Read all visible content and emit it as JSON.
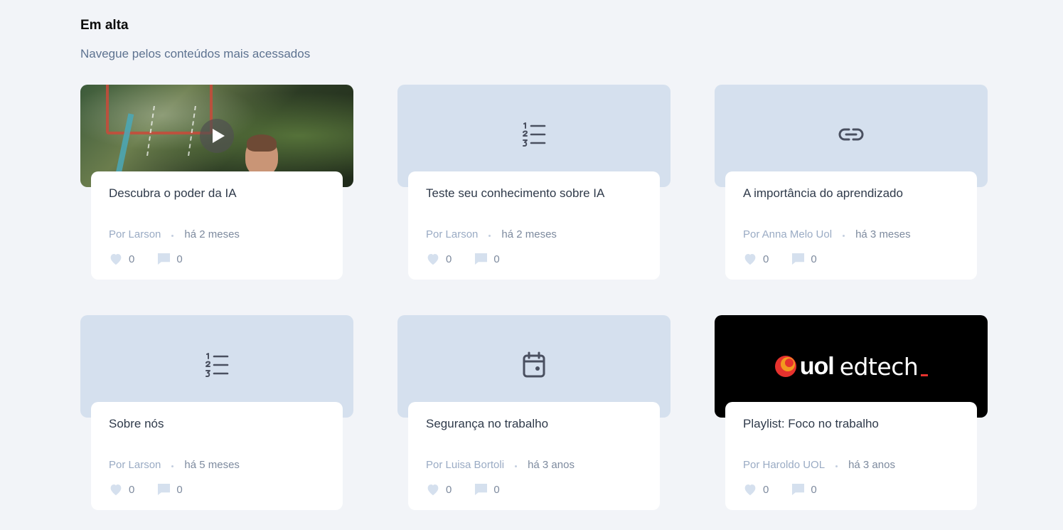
{
  "section": {
    "title": "Em alta",
    "subtitle": "Navegue pelos conteúdos mais acessados"
  },
  "cards": [
    {
      "thumb": "video-thumbnail",
      "icon": "play-icon",
      "title": "Descubra o poder da IA",
      "author": "Por Larson",
      "time": "há 2 meses",
      "likes": "0",
      "comments": "0"
    },
    {
      "thumb": "placeholder",
      "icon": "numbered-list-icon",
      "title": "Teste seu conhecimento sobre IA",
      "author": "Por Larson",
      "time": "há 2 meses",
      "likes": "0",
      "comments": "0"
    },
    {
      "thumb": "placeholder",
      "icon": "link-icon",
      "title": "A importância do aprendizado",
      "author": "Por Anna Melo Uol",
      "time": "há 3 meses",
      "likes": "0",
      "comments": "0"
    },
    {
      "thumb": "placeholder",
      "icon": "numbered-list-icon",
      "title": "Sobre nós",
      "author": "Por Larson",
      "time": "há 5 meses",
      "likes": "0",
      "comments": "0"
    },
    {
      "thumb": "placeholder",
      "icon": "calendar-icon",
      "title": "Segurança no trabalho",
      "author": "Por Luisa Bortoli",
      "time": "há 3 anos",
      "likes": "0",
      "comments": "0"
    },
    {
      "thumb": "brand-logo",
      "icon": "uol-edtech-logo",
      "title": "Playlist: Foco no trabalho",
      "author": "Por Haroldo UOL",
      "time": "há 3 anos",
      "likes": "0",
      "comments": "0"
    }
  ],
  "logo": {
    "brand": "uol",
    "product": "edtech"
  },
  "colors": {
    "background": "#f2f4f8",
    "thumb_placeholder": "#d5e0ee",
    "icon": "#4a5060",
    "author": "#9aabc4",
    "meta": "#7d8a9e",
    "stat_icon": "#d5e0ee",
    "accent_red": "#e6322e",
    "accent_orange": "#f29a1f"
  }
}
